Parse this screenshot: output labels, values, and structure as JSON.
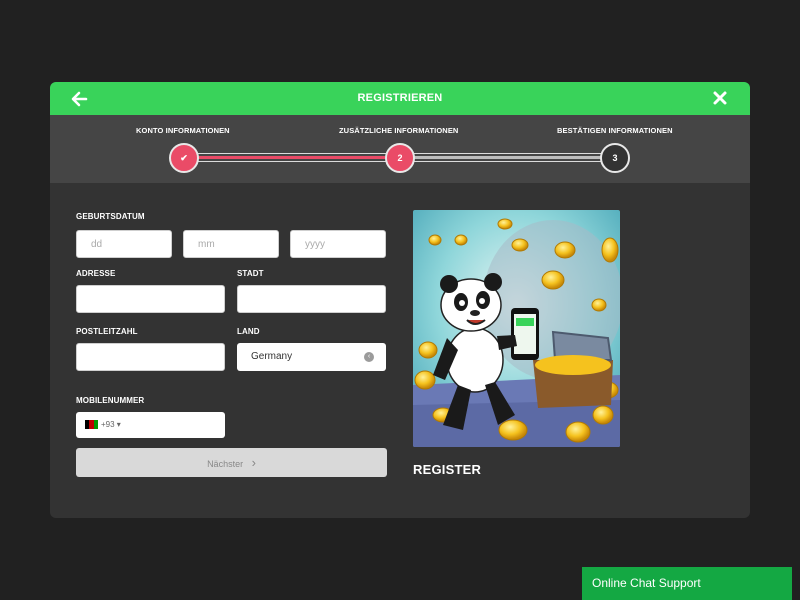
{
  "header": {
    "title": "REGISTRIEREN",
    "back_icon": "arrow-left-icon",
    "close_icon": "close-icon",
    "color": "#39d35a"
  },
  "steps": [
    {
      "label": "KONTO INFORMATIONEN",
      "marker": "✔",
      "state": "done"
    },
    {
      "label": "ZUSÄTZLICHE INFORMATIONEN",
      "marker": "2",
      "state": "active"
    },
    {
      "label": "BESTÄTIGEN INFORMATIONEN",
      "marker": "3",
      "state": "todo"
    }
  ],
  "form": {
    "birthdate_label": "GEBURTSDATUM",
    "day_placeholder": "dd",
    "month_placeholder": "mm",
    "year_placeholder": "yyyy",
    "address_label": "ADRESSE",
    "city_label": "STADT",
    "postcode_label": "POSTLEITZAHL",
    "country_label": "LAND",
    "country_value": "Germany",
    "mobile_label": "MOBILENUMMER",
    "phone_code": "+93",
    "next_label": "Nächster",
    "next_arrow": "›"
  },
  "promo": {
    "title": "REGISTER"
  },
  "chat": {
    "label": "Online Chat Support",
    "color": "#14a843"
  },
  "colors": {
    "accent_red": "#ea4b67",
    "modal_bg": "#333333",
    "page_bg": "#212121"
  }
}
